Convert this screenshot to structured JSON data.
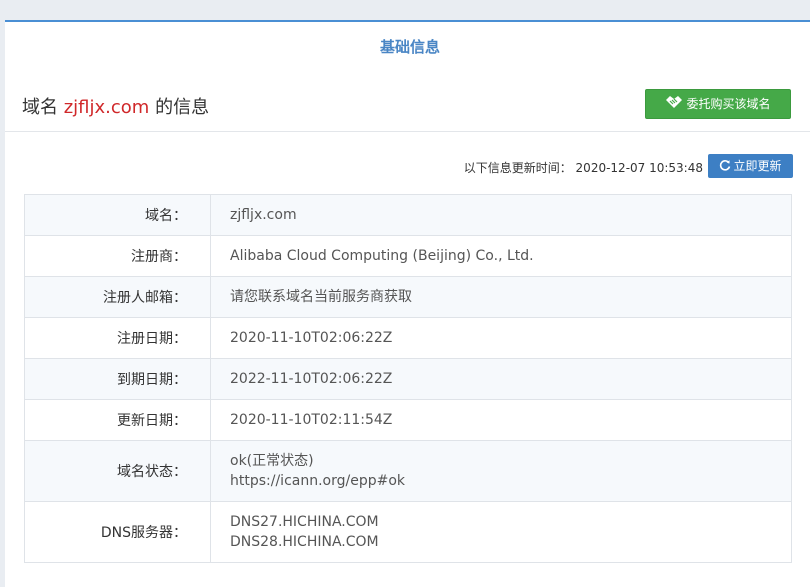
{
  "panel": {
    "title": "基础信息"
  },
  "heading": {
    "prefix": "域名 ",
    "domain": "zjfljx.com",
    "suffix": " 的信息"
  },
  "buy_button": {
    "label": "委托购买该域名",
    "icon": "handshake-icon"
  },
  "update": {
    "text": "以下信息更新时间： 2020-12-07 10:53:48",
    "button_label": "立即更新",
    "icon": "refresh-icon"
  },
  "info": [
    {
      "label": "域名：",
      "lines": [
        "zjfljx.com"
      ]
    },
    {
      "label": "注册商：",
      "lines": [
        "Alibaba Cloud Computing (Beijing) Co., Ltd."
      ]
    },
    {
      "label": "注册人邮箱：",
      "lines": [
        "请您联系域名当前服务商获取"
      ]
    },
    {
      "label": "注册日期：",
      "lines": [
        "2020-11-10T02:06:22Z"
      ]
    },
    {
      "label": "到期日期：",
      "lines": [
        "2022-11-10T02:06:22Z"
      ]
    },
    {
      "label": "更新日期：",
      "lines": [
        "2020-11-10T02:11:54Z"
      ]
    },
    {
      "label": "域名状态：",
      "lines": [
        "ok(正常状态)",
        "https://icann.org/epp#ok"
      ]
    },
    {
      "label": "DNS服务器：",
      "lines": [
        "DNS27.HICHINA.COM",
        "DNS28.HICHINA.COM"
      ]
    }
  ],
  "colors": {
    "accent": "#4a86c5",
    "buy_green": "#45a948",
    "domain_red": "#d0282a",
    "update_blue": "#3d7fc4"
  }
}
